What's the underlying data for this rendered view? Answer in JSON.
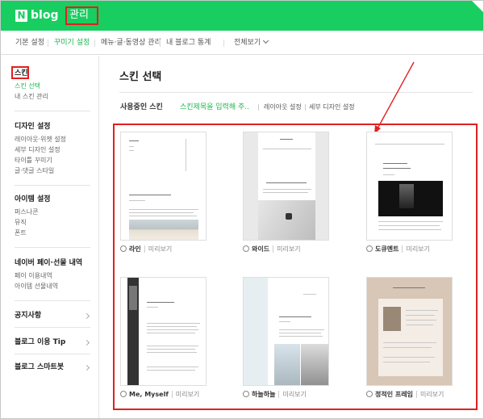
{
  "header": {
    "logo_mark": "N",
    "logo_text": "blog",
    "manage": "관리"
  },
  "tabs": [
    {
      "label": "기본 설정"
    },
    {
      "label": "꾸미기 설정"
    },
    {
      "label": "메뉴·글·동영상 관리"
    },
    {
      "label": "내 블로그 통계"
    },
    {
      "label": "전체보기"
    }
  ],
  "sidebar": {
    "skin": {
      "title": "스킨",
      "items": [
        "스킨 선택",
        "내 스킨 관리"
      ]
    },
    "design": {
      "title": "디자인 설정",
      "items": [
        "레이아웃·위젯 설정",
        "세부 디자인 설정",
        "타이틀 꾸미기",
        "글·댓글 스타일"
      ]
    },
    "item": {
      "title": "아이템 설정",
      "items": [
        "퍼스나콘",
        "뮤직",
        "폰트"
      ]
    },
    "pay": {
      "title": "네이버 페이·선물 내역",
      "items": [
        "페이 이용내역",
        "아이템 선물내역"
      ]
    },
    "notice": {
      "title": "공지사항"
    },
    "tip": {
      "title": "블로그 이용 Tip"
    },
    "smartbot": {
      "title": "블로그 스마트봇"
    }
  },
  "main": {
    "title": "스킨 선택",
    "in_use_label": "사용중인 스킨",
    "skin_name_placeholder": "스킨제목을 입력해 주..",
    "layout_link": "레이아웃 설정",
    "detail_link": "세부 디자인 설정",
    "preview_label": "미리보기"
  },
  "skins": [
    {
      "name": "라인"
    },
    {
      "name": "와이드"
    },
    {
      "name": "도큐멘트"
    },
    {
      "name": "Me, Myself"
    },
    {
      "name": "하늘하늘"
    },
    {
      "name": "정적인 프레임"
    }
  ],
  "colors": {
    "brand_green": "#19ce60",
    "active_green": "#19b84e",
    "highlight_red": "#e02020"
  }
}
